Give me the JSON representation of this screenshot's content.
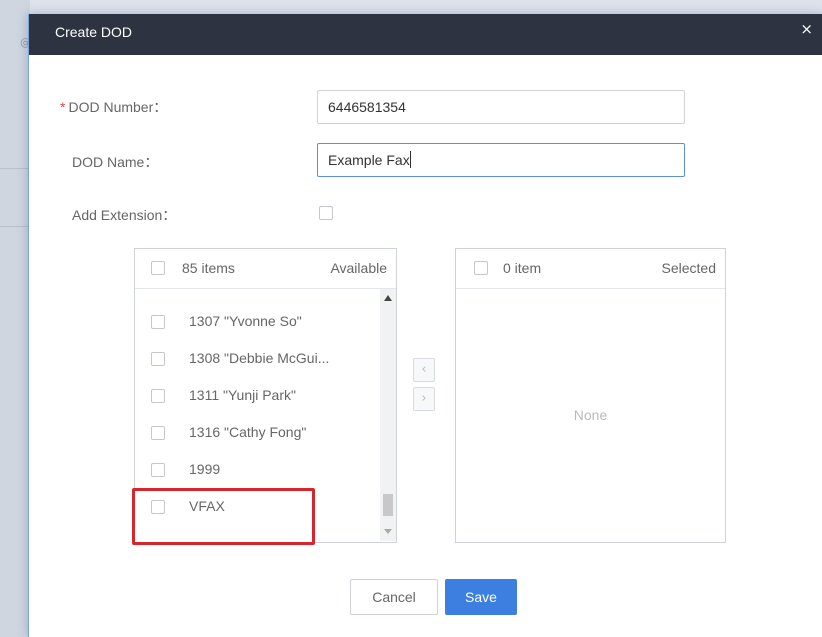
{
  "background": {
    "glyph": "@"
  },
  "dialog": {
    "title": "Create DOD",
    "close_icon": "×"
  },
  "form": {
    "dod_number": {
      "required_mark": "*",
      "label": "DOD Number：",
      "value": "6446581354"
    },
    "dod_name": {
      "label": "DOD Name：",
      "value": "Example Fax"
    },
    "add_extension": {
      "label": "Add Extension：",
      "checked": false
    }
  },
  "transfer": {
    "available": {
      "count": "85 items",
      "title": "Available",
      "items": [
        {
          "label": "1307 \"Yvonne So\""
        },
        {
          "label": "1308 \"Debbie McGui..."
        },
        {
          "label": "1311 \"Yunji Park\""
        },
        {
          "label": "1316 \"Cathy Fong\""
        },
        {
          "label": "1999"
        },
        {
          "label": "VFAX"
        }
      ]
    },
    "move_left_icon": "‹",
    "move_right_icon": "›",
    "selected": {
      "count": "0 item",
      "title": "Selected",
      "empty_text": "None"
    }
  },
  "buttons": {
    "cancel": "Cancel",
    "save": "Save"
  },
  "colors": {
    "titlebar": "#2d3340",
    "primary": "#3d7fe0",
    "required": "#e0463b",
    "highlight": "#d7262b"
  }
}
